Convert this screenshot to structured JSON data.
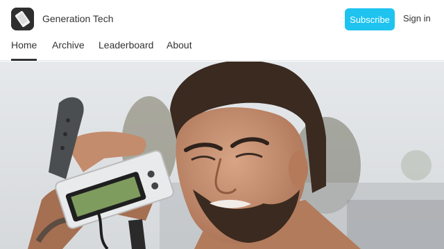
{
  "brand": {
    "name": "Generation Tech",
    "logo_icon": "phone-logo-icon"
  },
  "header": {
    "subscribe_label": "Subscribe",
    "signin_label": "Sign in",
    "accent": "#1ec3ef"
  },
  "nav": {
    "items": [
      {
        "label": "Home",
        "active": true
      },
      {
        "label": "Archive",
        "active": false
      },
      {
        "label": "Leaderboard",
        "active": false
      },
      {
        "label": "About",
        "active": false
      }
    ]
  }
}
